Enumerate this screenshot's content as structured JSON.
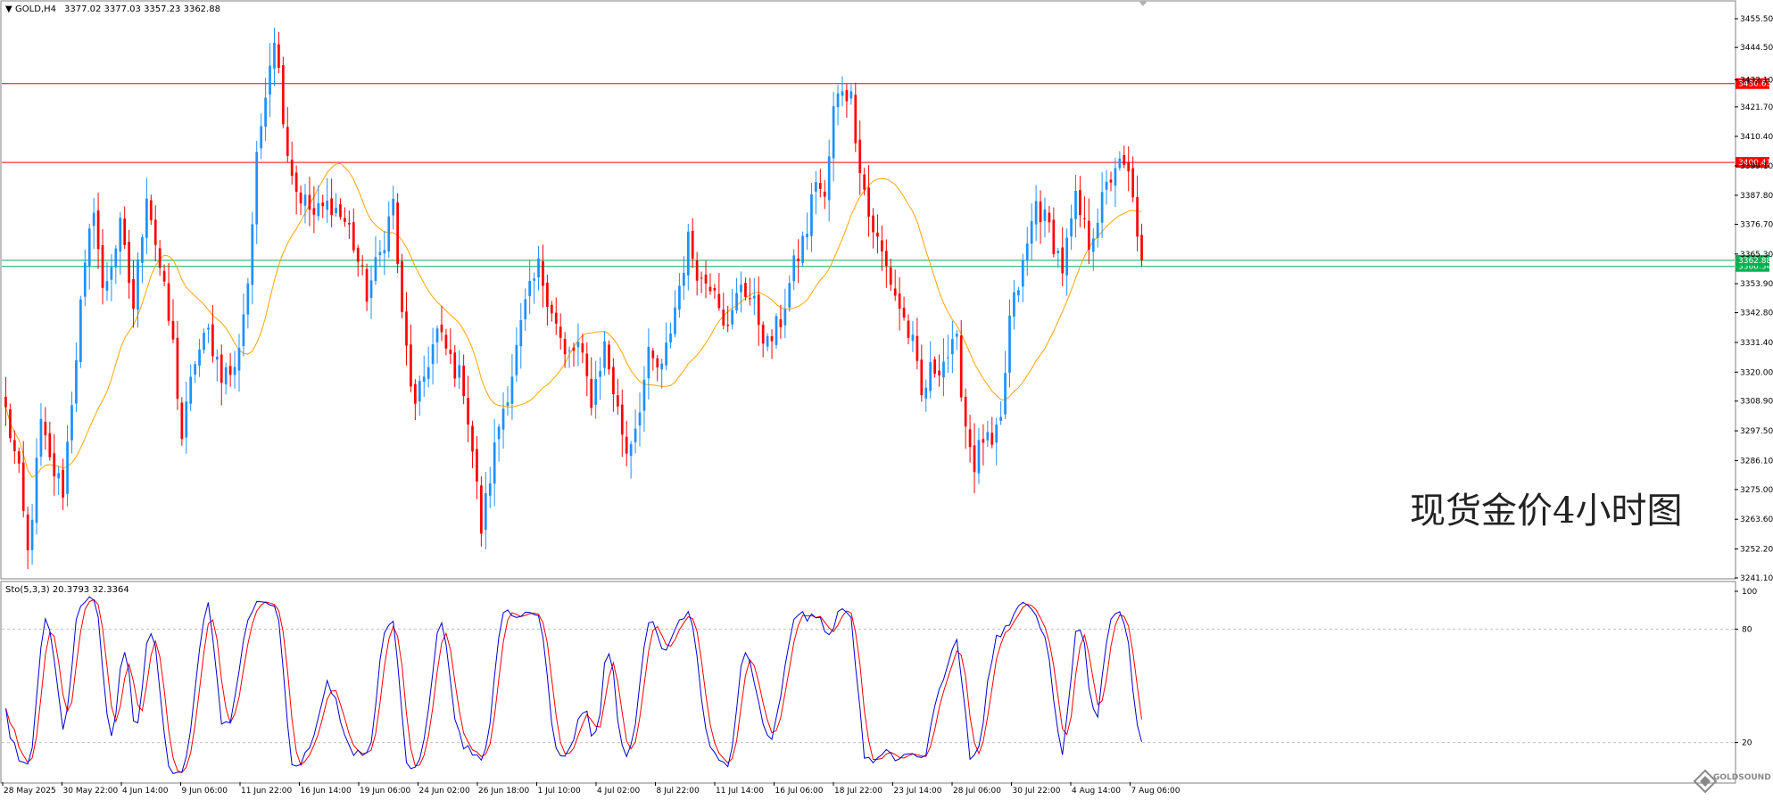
{
  "header": {
    "symbol": "GOLD,H4",
    "ohlc": "3377.02 3377.03 3357.23 3362.88"
  },
  "watermark": "现货金价4小时图",
  "logo": {
    "text": "GOLDSOUND"
  },
  "colors": {
    "bull": "#1E90FF",
    "bear": "#FF0000",
    "ma": "#FFA500",
    "resistance": "#FF0000",
    "support": "#00B050",
    "stoch_main": "#0000CC",
    "stoch_signal": "#FF0000",
    "grid": "#C0C0C0"
  },
  "chart_data": [
    {
      "type": "candlestick",
      "name": "GOLD,H4",
      "ylim": [
        3241.1,
        3462.0
      ],
      "y_ticks": [
        "3455.50",
        "3444.50",
        "3432.10",
        "3421.70",
        "3410.40",
        "3399.10",
        "3387.80",
        "3376.70",
        "3365.30",
        "3353.90",
        "3342.80",
        "3331.40",
        "3320.00",
        "3308.90",
        "3297.50",
        "3286.10",
        "3275.00",
        "3263.60",
        "3252.20",
        "3241.10"
      ],
      "x_ticks": [
        "28 May 2025",
        "30 May 22:00",
        "4 Jun 14:00",
        "9 Jun 06:00",
        "11 Jun 22:00",
        "16 Jun 14:00",
        "19 Jun 06:00",
        "24 Jun 02:00",
        "26 Jun 18:00",
        "1 Jul 10:00",
        "4 Jul 02:00",
        "8 Jul 22:00",
        "11 Jul 14:00",
        "16 Jul 06:00",
        "18 Jul 22:00",
        "23 Jul 14:00",
        "28 Jul 06:00",
        "30 Jul 22:00",
        "4 Aug 14:00",
        "7 Aug 06:00"
      ],
      "price_anchors": [
        [
          0,
          3305
        ],
        [
          3,
          3280
        ],
        [
          5,
          3250
        ],
        [
          8,
          3300
        ],
        [
          10,
          3285
        ],
        [
          13,
          3275
        ],
        [
          17,
          3345
        ],
        [
          20,
          3385
        ],
        [
          22,
          3350
        ],
        [
          26,
          3375
        ],
        [
          29,
          3345
        ],
        [
          32,
          3390
        ],
        [
          35,
          3360
        ],
        [
          38,
          3330
        ],
        [
          40,
          3295
        ],
        [
          43,
          3325
        ],
        [
          46,
          3335
        ],
        [
          49,
          3320
        ],
        [
          52,
          3320
        ],
        [
          55,
          3355
        ],
        [
          57,
          3400
        ],
        [
          59,
          3430
        ],
        [
          61,
          3450
        ],
        [
          64,
          3405
        ],
        [
          66,
          3390
        ],
        [
          70,
          3380
        ],
        [
          74,
          3385
        ],
        [
          78,
          3375
        ],
        [
          82,
          3350
        ],
        [
          85,
          3365
        ],
        [
          88,
          3385
        ],
        [
          90,
          3340
        ],
        [
          93,
          3305
        ],
        [
          96,
          3325
        ],
        [
          98,
          3335
        ],
        [
          101,
          3325
        ],
        [
          104,
          3315
        ],
        [
          106,
          3290
        ],
        [
          108,
          3260
        ],
        [
          110,
          3280
        ],
        [
          112,
          3300
        ],
        [
          115,
          3320
        ],
        [
          118,
          3345
        ],
        [
          121,
          3360
        ],
        [
          124,
          3345
        ],
        [
          127,
          3325
        ],
        [
          130,
          3330
        ],
        [
          133,
          3310
        ],
        [
          136,
          3330
        ],
        [
          139,
          3305
        ],
        [
          141,
          3290
        ],
        [
          143,
          3300
        ],
        [
          146,
          3325
        ],
        [
          149,
          3320
        ],
        [
          152,
          3345
        ],
        [
          155,
          3370
        ],
        [
          158,
          3355
        ],
        [
          161,
          3355
        ],
        [
          164,
          3335
        ],
        [
          167,
          3355
        ],
        [
          170,
          3345
        ],
        [
          173,
          3330
        ],
        [
          176,
          3340
        ],
        [
          179,
          3360
        ],
        [
          182,
          3375
        ],
        [
          184,
          3395
        ],
        [
          186,
          3385
        ],
        [
          188,
          3420
        ],
        [
          190,
          3430
        ],
        [
          192,
          3425
        ],
        [
          194,
          3400
        ],
        [
          196,
          3380
        ],
        [
          198,
          3370
        ],
        [
          200,
          3360
        ],
        [
          203,
          3345
        ],
        [
          206,
          3330
        ],
        [
          208,
          3310
        ],
        [
          210,
          3320
        ],
        [
          213,
          3325
        ],
        [
          216,
          3330
        ],
        [
          218,
          3300
        ],
        [
          220,
          3285
        ],
        [
          222,
          3295
        ],
        [
          224,
          3290
        ],
        [
          226,
          3300
        ],
        [
          228,
          3340
        ],
        [
          231,
          3360
        ],
        [
          234,
          3385
        ],
        [
          237,
          3375
        ],
        [
          240,
          3360
        ],
        [
          243,
          3385
        ],
        [
          246,
          3370
        ],
        [
          249,
          3385
        ],
        [
          252,
          3400
        ],
        [
          255,
          3395
        ],
        [
          257,
          3375
        ],
        [
          258,
          3362.88
        ]
      ],
      "levels": [
        {
          "label": "3430.63",
          "value": 3430.63,
          "color": "resistance"
        },
        {
          "label": "3400.41",
          "value": 3400.41,
          "color": "resistance"
        },
        {
          "label": "3360.54",
          "value": 3360.54,
          "color": "support"
        },
        {
          "label": "3362.88",
          "value": 3362.88,
          "color": "support"
        }
      ],
      "bar_count": 259,
      "ma_period": 20
    },
    {
      "type": "line",
      "name": "Sto(5,3,3) 20.3793 32.3364",
      "label": "Sto(5,3,3) 20.3793 32.3364",
      "ylim": [
        0,
        100
      ],
      "y_ticks": [
        "100",
        "80",
        "20"
      ],
      "levels": [
        80,
        20
      ],
      "series": [
        {
          "name": "main",
          "value": 20.3793
        },
        {
          "name": "signal",
          "value": 32.3364
        }
      ]
    }
  ]
}
